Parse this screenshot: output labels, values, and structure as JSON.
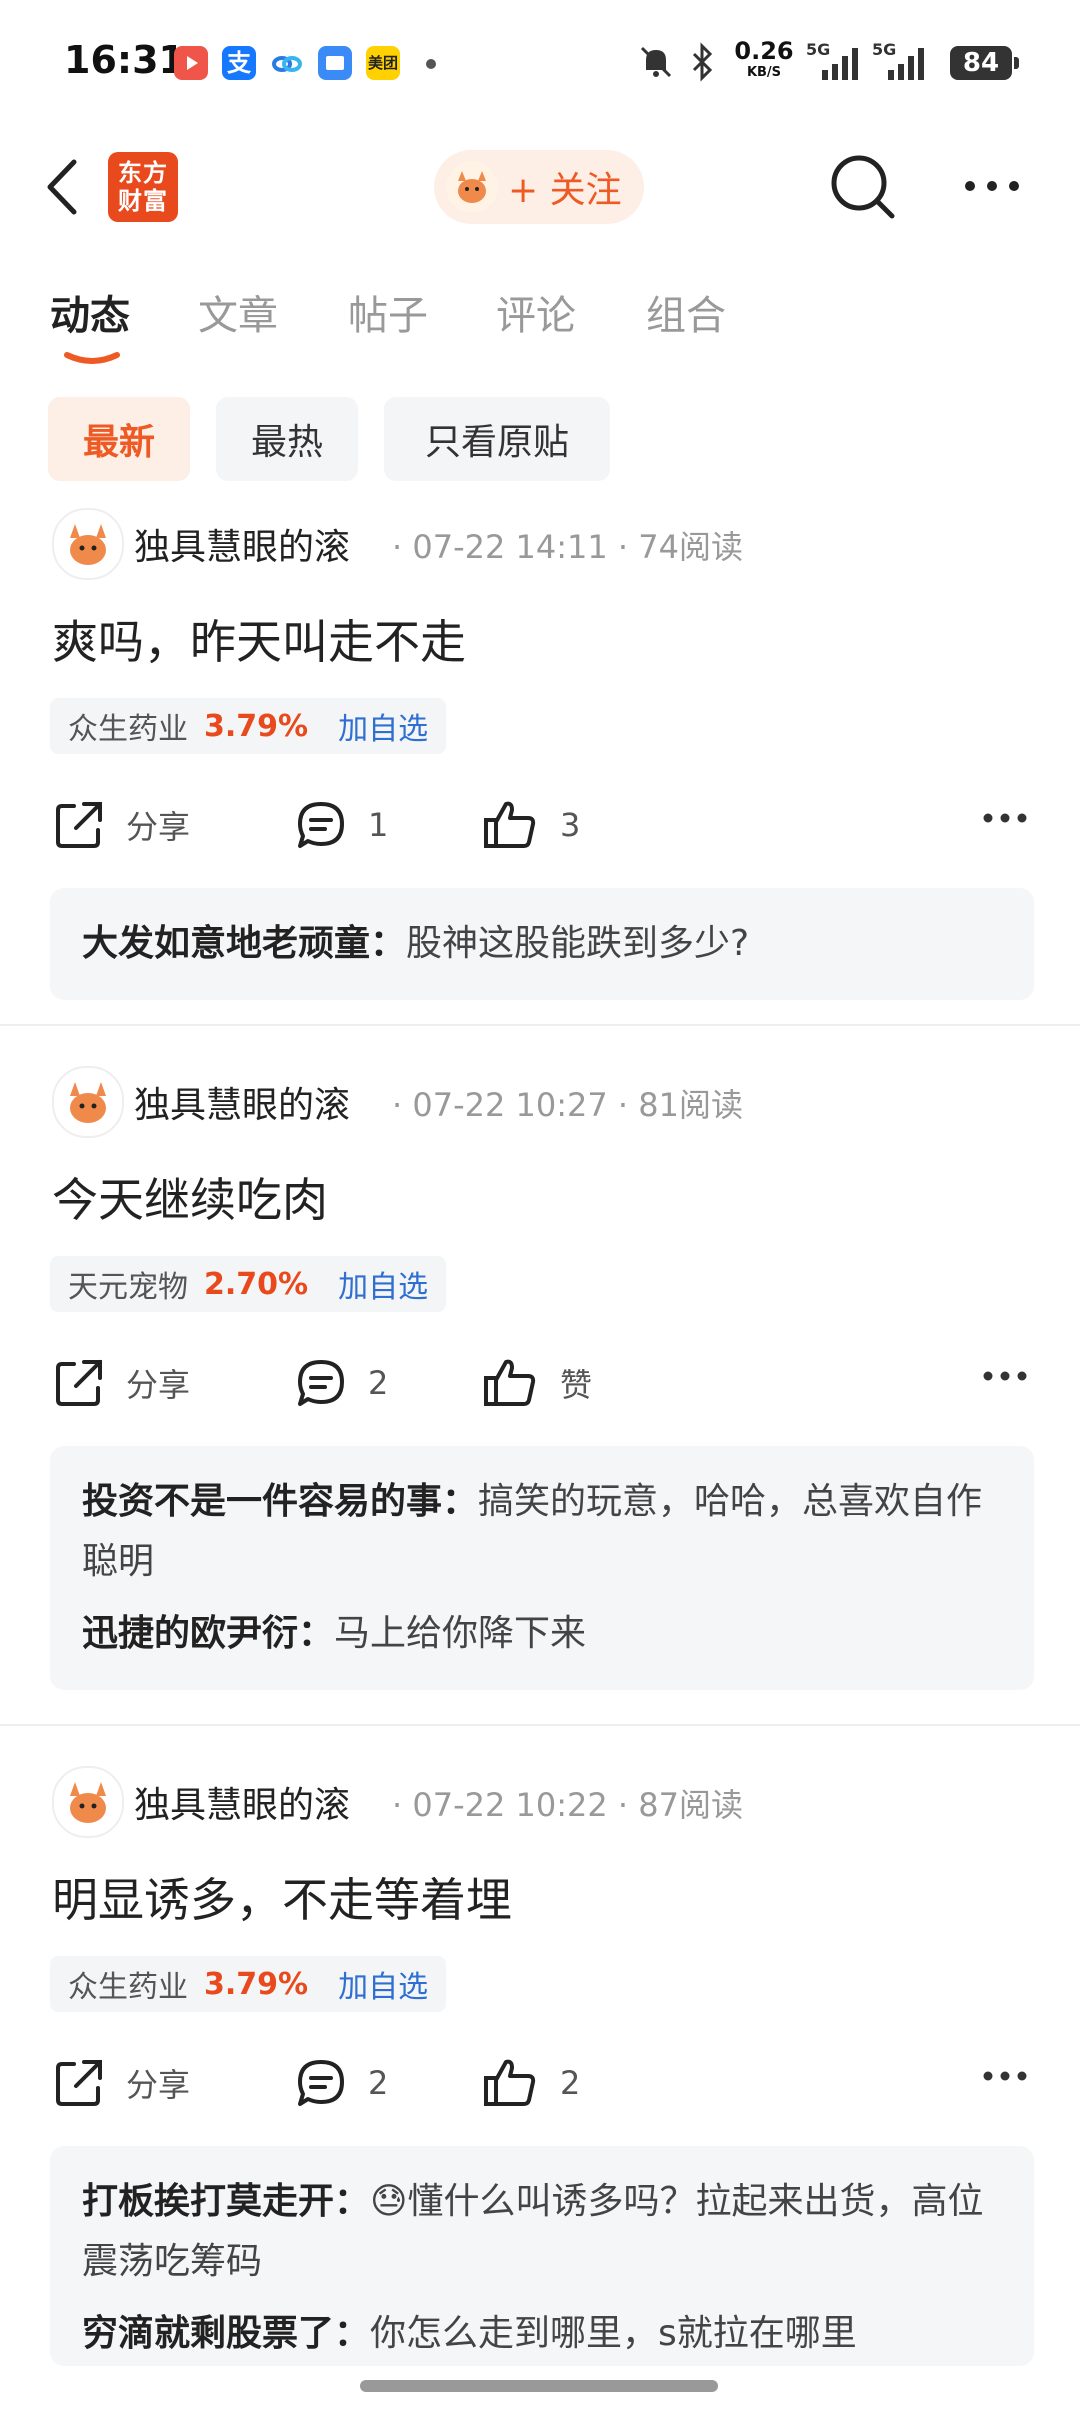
{
  "status_bar": {
    "time": "16:31",
    "net_speed": "0.26",
    "net_unit": "KB/S",
    "signal_1": "5G",
    "signal_2": "5G",
    "battery": "84",
    "app_icons": [
      "video-app-icon",
      "alipay-icon",
      "cloud-app-icon",
      "files-app-icon",
      "meituan-icon"
    ],
    "meituan_label": "美团",
    "alipay_label": "支"
  },
  "header": {
    "logo_text": "东方财富",
    "follow_label": "+ 关注"
  },
  "tabs": [
    {
      "label": "动态",
      "active": true
    },
    {
      "label": "文章",
      "active": false
    },
    {
      "label": "帖子",
      "active": false
    },
    {
      "label": "评论",
      "active": false
    },
    {
      "label": "组合",
      "active": false
    }
  ],
  "filters": [
    {
      "label": "最新",
      "active": true
    },
    {
      "label": "最热",
      "active": false
    },
    {
      "label": "只看原贴",
      "active": false
    }
  ],
  "posts": [
    {
      "username": "独具慧眼的滚",
      "meta": "· 07-22 14:11 · 74阅读",
      "content": "爽吗，昨天叫走不走",
      "stock_name": "众生药业",
      "stock_change": "3.79%",
      "add_label": "加自选",
      "share_label": "分享",
      "comment_count": "1",
      "like_label": "3",
      "comments": [
        {
          "name": "大发如意地老顽童：",
          "text": "股神这股能跌到多少?"
        }
      ]
    },
    {
      "username": "独具慧眼的滚",
      "meta": "· 07-22 10:27 · 81阅读",
      "content": "今天继续吃肉",
      "stock_name": "天元宠物",
      "stock_change": "2.70%",
      "add_label": "加自选",
      "share_label": "分享",
      "comment_count": "2",
      "like_label": "赞",
      "comments": [
        {
          "name": "投资不是一件容易的事：",
          "text": "搞笑的玩意，哈哈，总喜欢自作聪明"
        },
        {
          "name": "迅捷的欧尹衍：",
          "text": "马上给你降下来"
        }
      ]
    },
    {
      "username": "独具慧眼的滚",
      "meta": "· 07-22 10:22 · 87阅读",
      "content": "明显诱多，不走等着埋",
      "stock_name": "众生药业",
      "stock_change": "3.79%",
      "add_label": "加自选",
      "share_label": "分享",
      "comment_count": "2",
      "like_label": "2",
      "comments": [
        {
          "name": "打板挨打莫走开：",
          "text": "懂什么叫诱多吗？拉起来出货，高位震荡吃筹码",
          "emoji": "😓"
        },
        {
          "name": "穷滴就剩股票了：",
          "text": "你怎么走到哪里，s就拉在哪里"
        }
      ]
    }
  ],
  "colors": {
    "accent": "#ee5a24",
    "stock_up": "#e8491d",
    "link": "#2f6fd1"
  }
}
